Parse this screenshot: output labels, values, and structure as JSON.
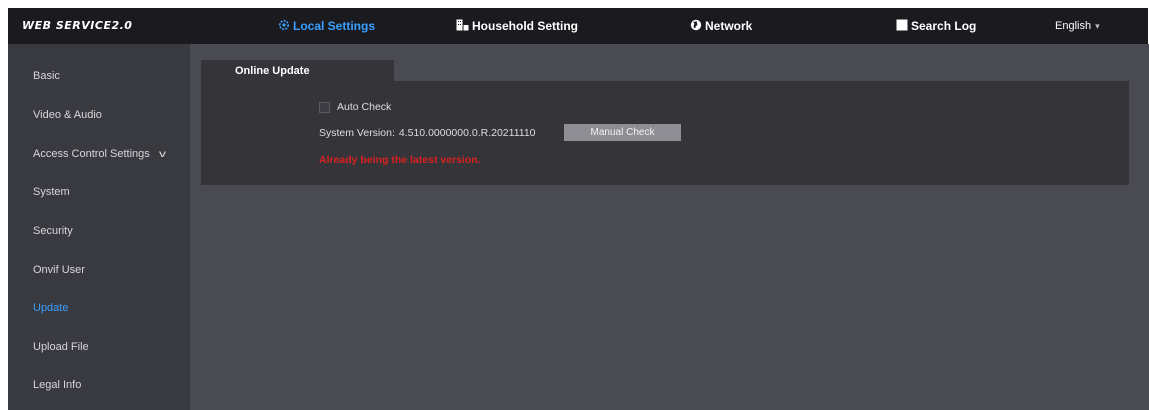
{
  "header": {
    "logo": "WEB SERVICE2.0",
    "nav": [
      {
        "label": "Local Settings",
        "icon": "gear-icon",
        "active": true
      },
      {
        "label": "Household Setting",
        "icon": "building-icon",
        "active": false
      },
      {
        "label": "Network",
        "icon": "globe-icon",
        "active": false
      },
      {
        "label": "Search Log",
        "icon": "document-icon",
        "active": false
      }
    ],
    "language": "English"
  },
  "sidebar": {
    "items": [
      {
        "label": "Basic"
      },
      {
        "label": "Video & Audio"
      },
      {
        "label": "Access Control Settings"
      },
      {
        "label": "System"
      },
      {
        "label": "Security"
      },
      {
        "label": "Onvif User"
      },
      {
        "label": "Update"
      },
      {
        "label": "Upload File"
      },
      {
        "label": "Legal Info"
      }
    ],
    "active_item": "Update"
  },
  "main": {
    "tab_label": "Online Update",
    "auto_check_label": "Auto Check",
    "auto_check_checked": false,
    "version_label": "System Version:",
    "version_value": "4.510.0000000.0.R.20211110",
    "manual_check_label": "Manual Check",
    "status_message": "Already being the latest version."
  },
  "colors": {
    "accent": "#3aa0ff",
    "error": "#d92020",
    "topbar": "#1a1a1f",
    "sidebar": "#393940",
    "content": "#4a4a52",
    "panel": "#353539"
  }
}
